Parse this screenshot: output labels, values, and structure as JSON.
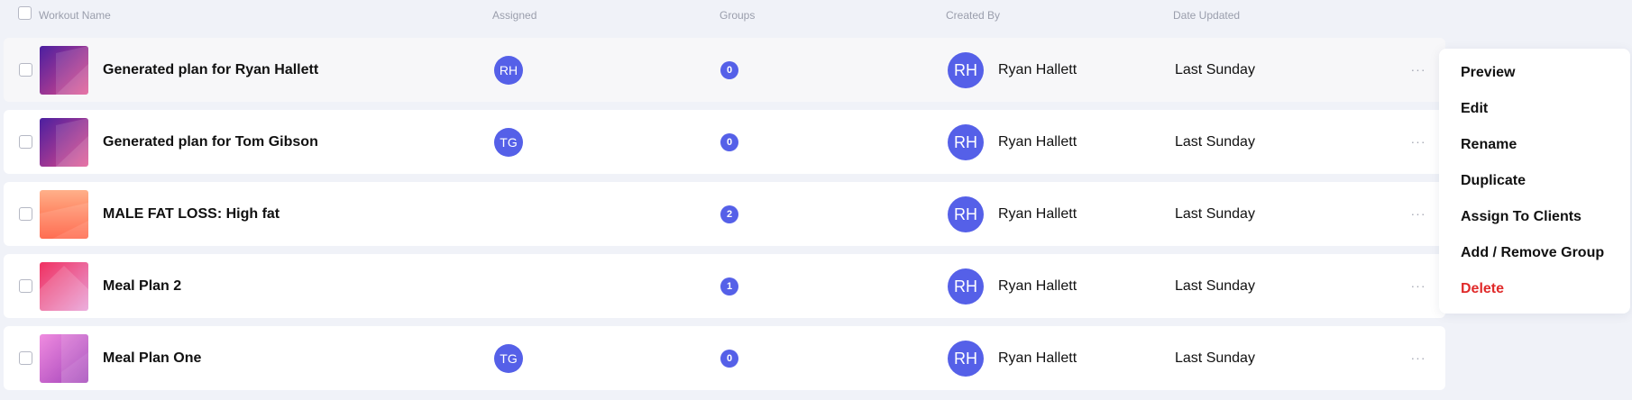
{
  "table": {
    "columns": {
      "workout_name": "Workout Name",
      "assigned": "Assigned",
      "groups": "Groups",
      "created_by": "Created By",
      "date_updated": "Date Updated"
    },
    "rows": [
      {
        "name": "Generated plan for Ryan Hallett",
        "assigned": "RH",
        "groups": "0",
        "creator_initials": "RH",
        "creator": "Ryan Hallett",
        "date": "Last Sunday",
        "more_icon": "···",
        "thumb": "thumb-purple"
      },
      {
        "name": "Generated plan for Tom Gibson",
        "assigned": "TG",
        "groups": "0",
        "creator_initials": "RH",
        "creator": "Ryan Hallett",
        "date": "Last Sunday",
        "more_icon": "···",
        "thumb": "thumb-purple"
      },
      {
        "name": "MALE FAT LOSS: High fat",
        "assigned": "",
        "groups": "2",
        "creator_initials": "RH",
        "creator": "Ryan Hallett",
        "date": "Last Sunday",
        "more_icon": "···",
        "thumb": "thumb-orange"
      },
      {
        "name": "Meal Plan 2",
        "assigned": "",
        "groups": "1",
        "creator_initials": "RH",
        "creator": "Ryan Hallett",
        "date": "Last Sunday",
        "more_icon": "···",
        "thumb": "thumb-pink"
      },
      {
        "name": "Meal Plan One",
        "assigned": "TG",
        "groups": "0",
        "creator_initials": "RH",
        "creator": "Ryan Hallett",
        "date": "Last Sunday",
        "more_icon": "···",
        "thumb": "thumb-violet"
      }
    ]
  },
  "context_menu": {
    "items": [
      "Preview",
      "Edit",
      "Rename",
      "Duplicate",
      "Assign To Clients",
      "Add / Remove Group",
      "Delete"
    ]
  },
  "colors": {
    "accent": "#5560e8",
    "danger": "#e02a2a",
    "background": "#f0f2f8"
  }
}
